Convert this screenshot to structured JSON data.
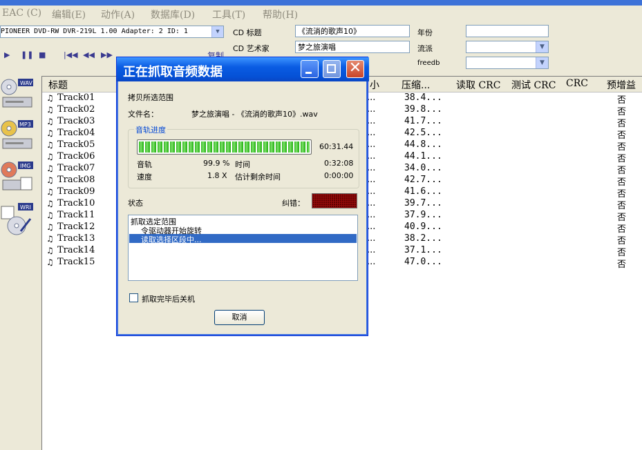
{
  "menu": [
    "EAC (C)",
    "编辑(E)",
    "动作(A)",
    "数据库(D)",
    "工具(T)",
    "帮助(H)"
  ],
  "drive": "PIONEER DVD-RW  DVR-219L 1.00  Adapter: 2  ID: 1",
  "cd_fields": {
    "title_label": "CD 标题",
    "title_value": "《流淌的歌声10》",
    "artist_label": "CD 艺术家",
    "artist_value": "梦之旅演唱",
    "year_label": "年份",
    "year_value": "",
    "genre_label": "流派",
    "genre_value": "",
    "freedb_label": "freedb",
    "freedb_value": ""
  },
  "toolbar_label": "复制",
  "side_icons": [
    "WAV",
    "MP3",
    "IMG",
    "WRI"
  ],
  "columns": [
    "标题",
    "小",
    "压缩...",
    "读取 CRC",
    "测试 CRC",
    "CRC",
    "预增益"
  ],
  "tracks": [
    {
      "title": "Track01",
      "size": "...",
      "compress": "38.4...",
      "pre": "否"
    },
    {
      "title": "Track02",
      "size": "...",
      "compress": "39.8...",
      "pre": "否"
    },
    {
      "title": "Track03",
      "size": "...",
      "compress": "41.7...",
      "pre": "否"
    },
    {
      "title": "Track04",
      "size": "...",
      "compress": "42.5...",
      "pre": "否"
    },
    {
      "title": "Track05",
      "size": "...",
      "compress": "44.8...",
      "pre": "否"
    },
    {
      "title": "Track06",
      "size": "...",
      "compress": "44.1...",
      "pre": "否"
    },
    {
      "title": "Track07",
      "size": "...",
      "compress": "34.0...",
      "pre": "否"
    },
    {
      "title": "Track08",
      "size": "...",
      "compress": "42.7...",
      "pre": "否"
    },
    {
      "title": "Track09",
      "size": "...",
      "compress": "41.6...",
      "pre": "否"
    },
    {
      "title": "Track10",
      "size": "...",
      "compress": "39.7...",
      "pre": "否"
    },
    {
      "title": "Track11",
      "size": "...",
      "compress": "37.9...",
      "pre": "否"
    },
    {
      "title": "Track12",
      "size": "...",
      "compress": "40.9...",
      "pre": "否"
    },
    {
      "title": "Track13",
      "size": "...",
      "compress": "38.2...",
      "pre": "否"
    },
    {
      "title": "Track14",
      "size": "...",
      "compress": "37.1...",
      "pre": "否"
    },
    {
      "title": "Track15",
      "size": "...",
      "compress": "47.0...",
      "pre": "否"
    }
  ],
  "dialog": {
    "title": "正在抓取音频数据",
    "copy_range": "拷贝所选范围",
    "file_label": "文件名：",
    "file_value": "梦之旅演唱 - 《流淌的歌声10》.wav",
    "group_title": "音轨进度",
    "progress_fraction": 0.999,
    "progress_time": "60:31.44",
    "track_label": "音轨",
    "track_value": "99.9 %",
    "time_label": "时间",
    "time_value": "0:32:08",
    "speed_label": "速度",
    "speed_value": "1.8 X",
    "remaining_label": "估计剩余时间",
    "remaining_value": "0:00:00",
    "status_label": "状态",
    "error_label": "纠错：",
    "log": [
      "抓取选定范围",
      "令驱动器开始旋转",
      "读取选择区段中..."
    ],
    "shutdown_label": "抓取完毕后关机",
    "cancel_label": "取消"
  },
  "colors": {
    "dialog_title": "#0a5ce3",
    "selection": "#316ac5",
    "group_title": "#0046d5",
    "progress": "#2eb71d"
  }
}
